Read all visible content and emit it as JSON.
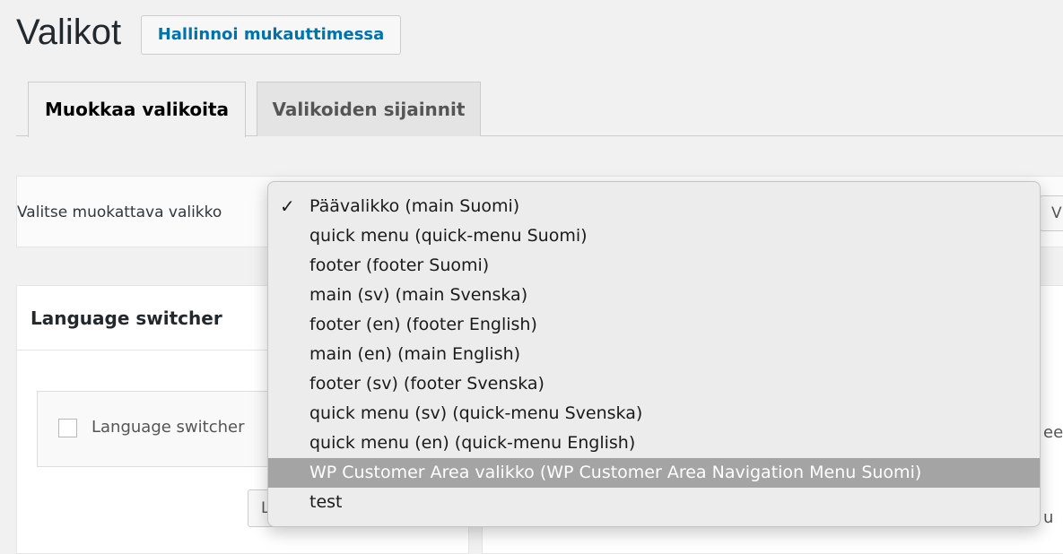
{
  "page": {
    "title": "Valikot",
    "manage_button": "Hallinnoi mukauttimessa"
  },
  "tabs": [
    {
      "label": "Muokkaa valikoita",
      "active": true
    },
    {
      "label": "Valikoiden sijainnit",
      "active": false
    }
  ],
  "menu_select": {
    "label": "Valitse muokattava valikko",
    "button_label": "V"
  },
  "sidebar": {
    "section_title": "Language switcher",
    "checkbox_label": "Language switcher",
    "add_button_label": "L"
  },
  "right_panel": {
    "text_fragment": "ee",
    "text_fragment_2": "u"
  },
  "dropdown": {
    "check_glyph": "✓",
    "options": [
      {
        "label": "Päävalikko (main Suomi)",
        "checked": true,
        "highlighted": false
      },
      {
        "label": "quick menu (quick-menu Suomi)",
        "checked": false,
        "highlighted": false
      },
      {
        "label": "footer (footer Suomi)",
        "checked": false,
        "highlighted": false
      },
      {
        "label": "main (sv) (main Svenska)",
        "checked": false,
        "highlighted": false
      },
      {
        "label": "footer (en) (footer English)",
        "checked": false,
        "highlighted": false
      },
      {
        "label": "main (en) (main English)",
        "checked": false,
        "highlighted": false
      },
      {
        "label": "footer (sv) (footer Svenska)",
        "checked": false,
        "highlighted": false
      },
      {
        "label": "quick menu (sv) (quick-menu Svenska)",
        "checked": false,
        "highlighted": false
      },
      {
        "label": "quick menu (en) (quick-menu English)",
        "checked": false,
        "highlighted": false
      },
      {
        "label": "WP Customer Area valikko (WP Customer Area Navigation Menu Suomi)",
        "checked": false,
        "highlighted": true
      },
      {
        "label": "test",
        "checked": false,
        "highlighted": false
      }
    ]
  }
}
